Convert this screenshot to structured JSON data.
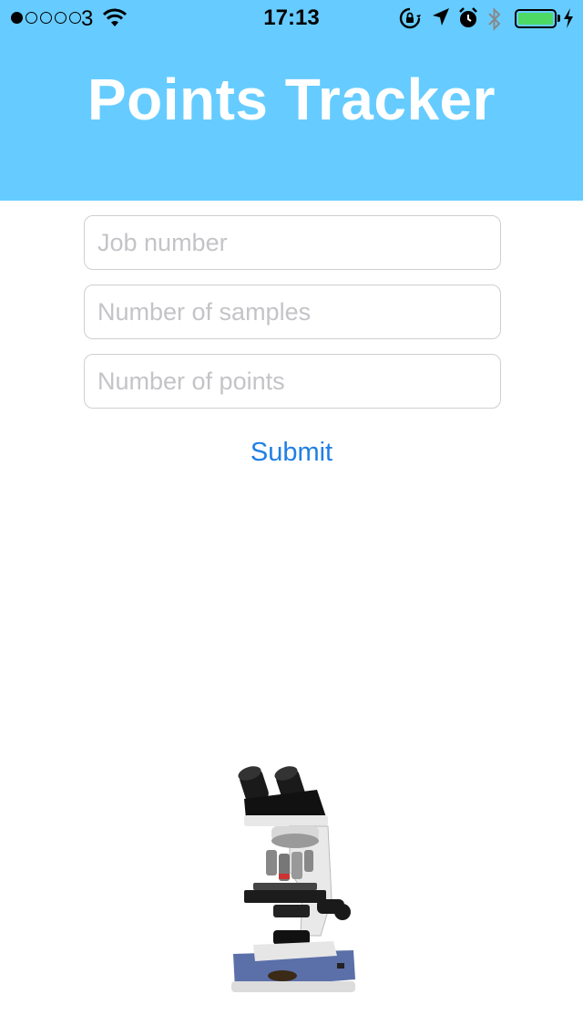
{
  "status_bar": {
    "carrier": "3",
    "time": "17:13",
    "signal_dots_filled": 1,
    "signal_dots_total": 5,
    "battery_level": 1.0,
    "icons": [
      "wifi-icon",
      "rotation-lock-icon",
      "location-icon",
      "alarm-icon",
      "bluetooth-icon",
      "battery-icon",
      "charging-icon"
    ]
  },
  "header": {
    "title": "Points Tracker",
    "background_color": "#66ccff"
  },
  "form": {
    "job_number": {
      "value": "",
      "placeholder": "Job number"
    },
    "samples": {
      "value": "",
      "placeholder": "Number of samples"
    },
    "points": {
      "value": "",
      "placeholder": "Number of points"
    },
    "submit_label": "Submit",
    "accent_color": "#1f7fe6"
  },
  "image": {
    "name": "microscope-image"
  }
}
